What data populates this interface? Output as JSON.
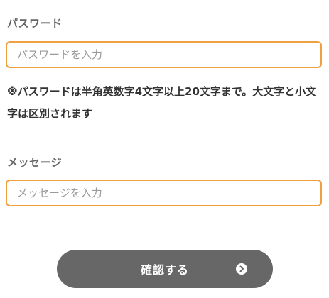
{
  "password": {
    "label": "パスワード",
    "placeholder": "パスワードを入力",
    "value": "",
    "note": "※パスワードは半角英数字4文字以上20文字まで。大文字と小文字は区別されます"
  },
  "message": {
    "label": "メッセージ",
    "placeholder": "メッセージを入力",
    "value": ""
  },
  "submit": {
    "label": "確認する",
    "icon": "chevron-right-circle-icon"
  },
  "colors": {
    "field_border": "#f0a040",
    "button_bg": "#676767"
  }
}
